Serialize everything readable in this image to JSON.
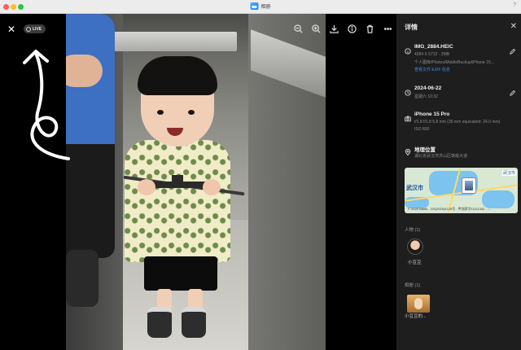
{
  "window": {
    "title": "相册",
    "help": "?"
  },
  "viewer": {
    "live_label": "LIVE",
    "toolbar": [
      "zoom-out-icon",
      "zoom-in-icon",
      "download-icon",
      "info-icon",
      "delete-icon",
      "more-icon"
    ]
  },
  "panel": {
    "header": "详情",
    "file": {
      "name": "IMG_2884.HEIC",
      "meta": "4284 X 5712 · 2MB",
      "path": "个人图库/Photos/MobileBackup/iPhone 15...",
      "exif_link": "查看文件 EXIF 信息"
    },
    "date": {
      "date": "2024-06-22",
      "time": "星期六 10:32"
    },
    "camera": {
      "model": "iPhone 15 Pro",
      "lens": "f/1.8 f/1.8 5.8 mm (35 mm equivalent: 24.0 mm)",
      "iso": "ISO 800"
    },
    "location": {
      "title": "地理位置",
      "address": "湖北省武汉市洪山区珞喻大道",
      "map_city": "武汉市",
      "map_city2": "武汉市",
      "map_copyright": "© 2025 Baidu - GS(2025)4125号 - 甲测资字11111342 - ..."
    },
    "people": {
      "label": "人物 (1)",
      "name": "小豆豆"
    },
    "albums": {
      "label": "相册 (1)",
      "name": "小豆豆的..."
    }
  },
  "colors": {
    "panel_bg": "#1e1e1e",
    "link": "#3a8ef0",
    "viewer_bg": "#000000"
  }
}
